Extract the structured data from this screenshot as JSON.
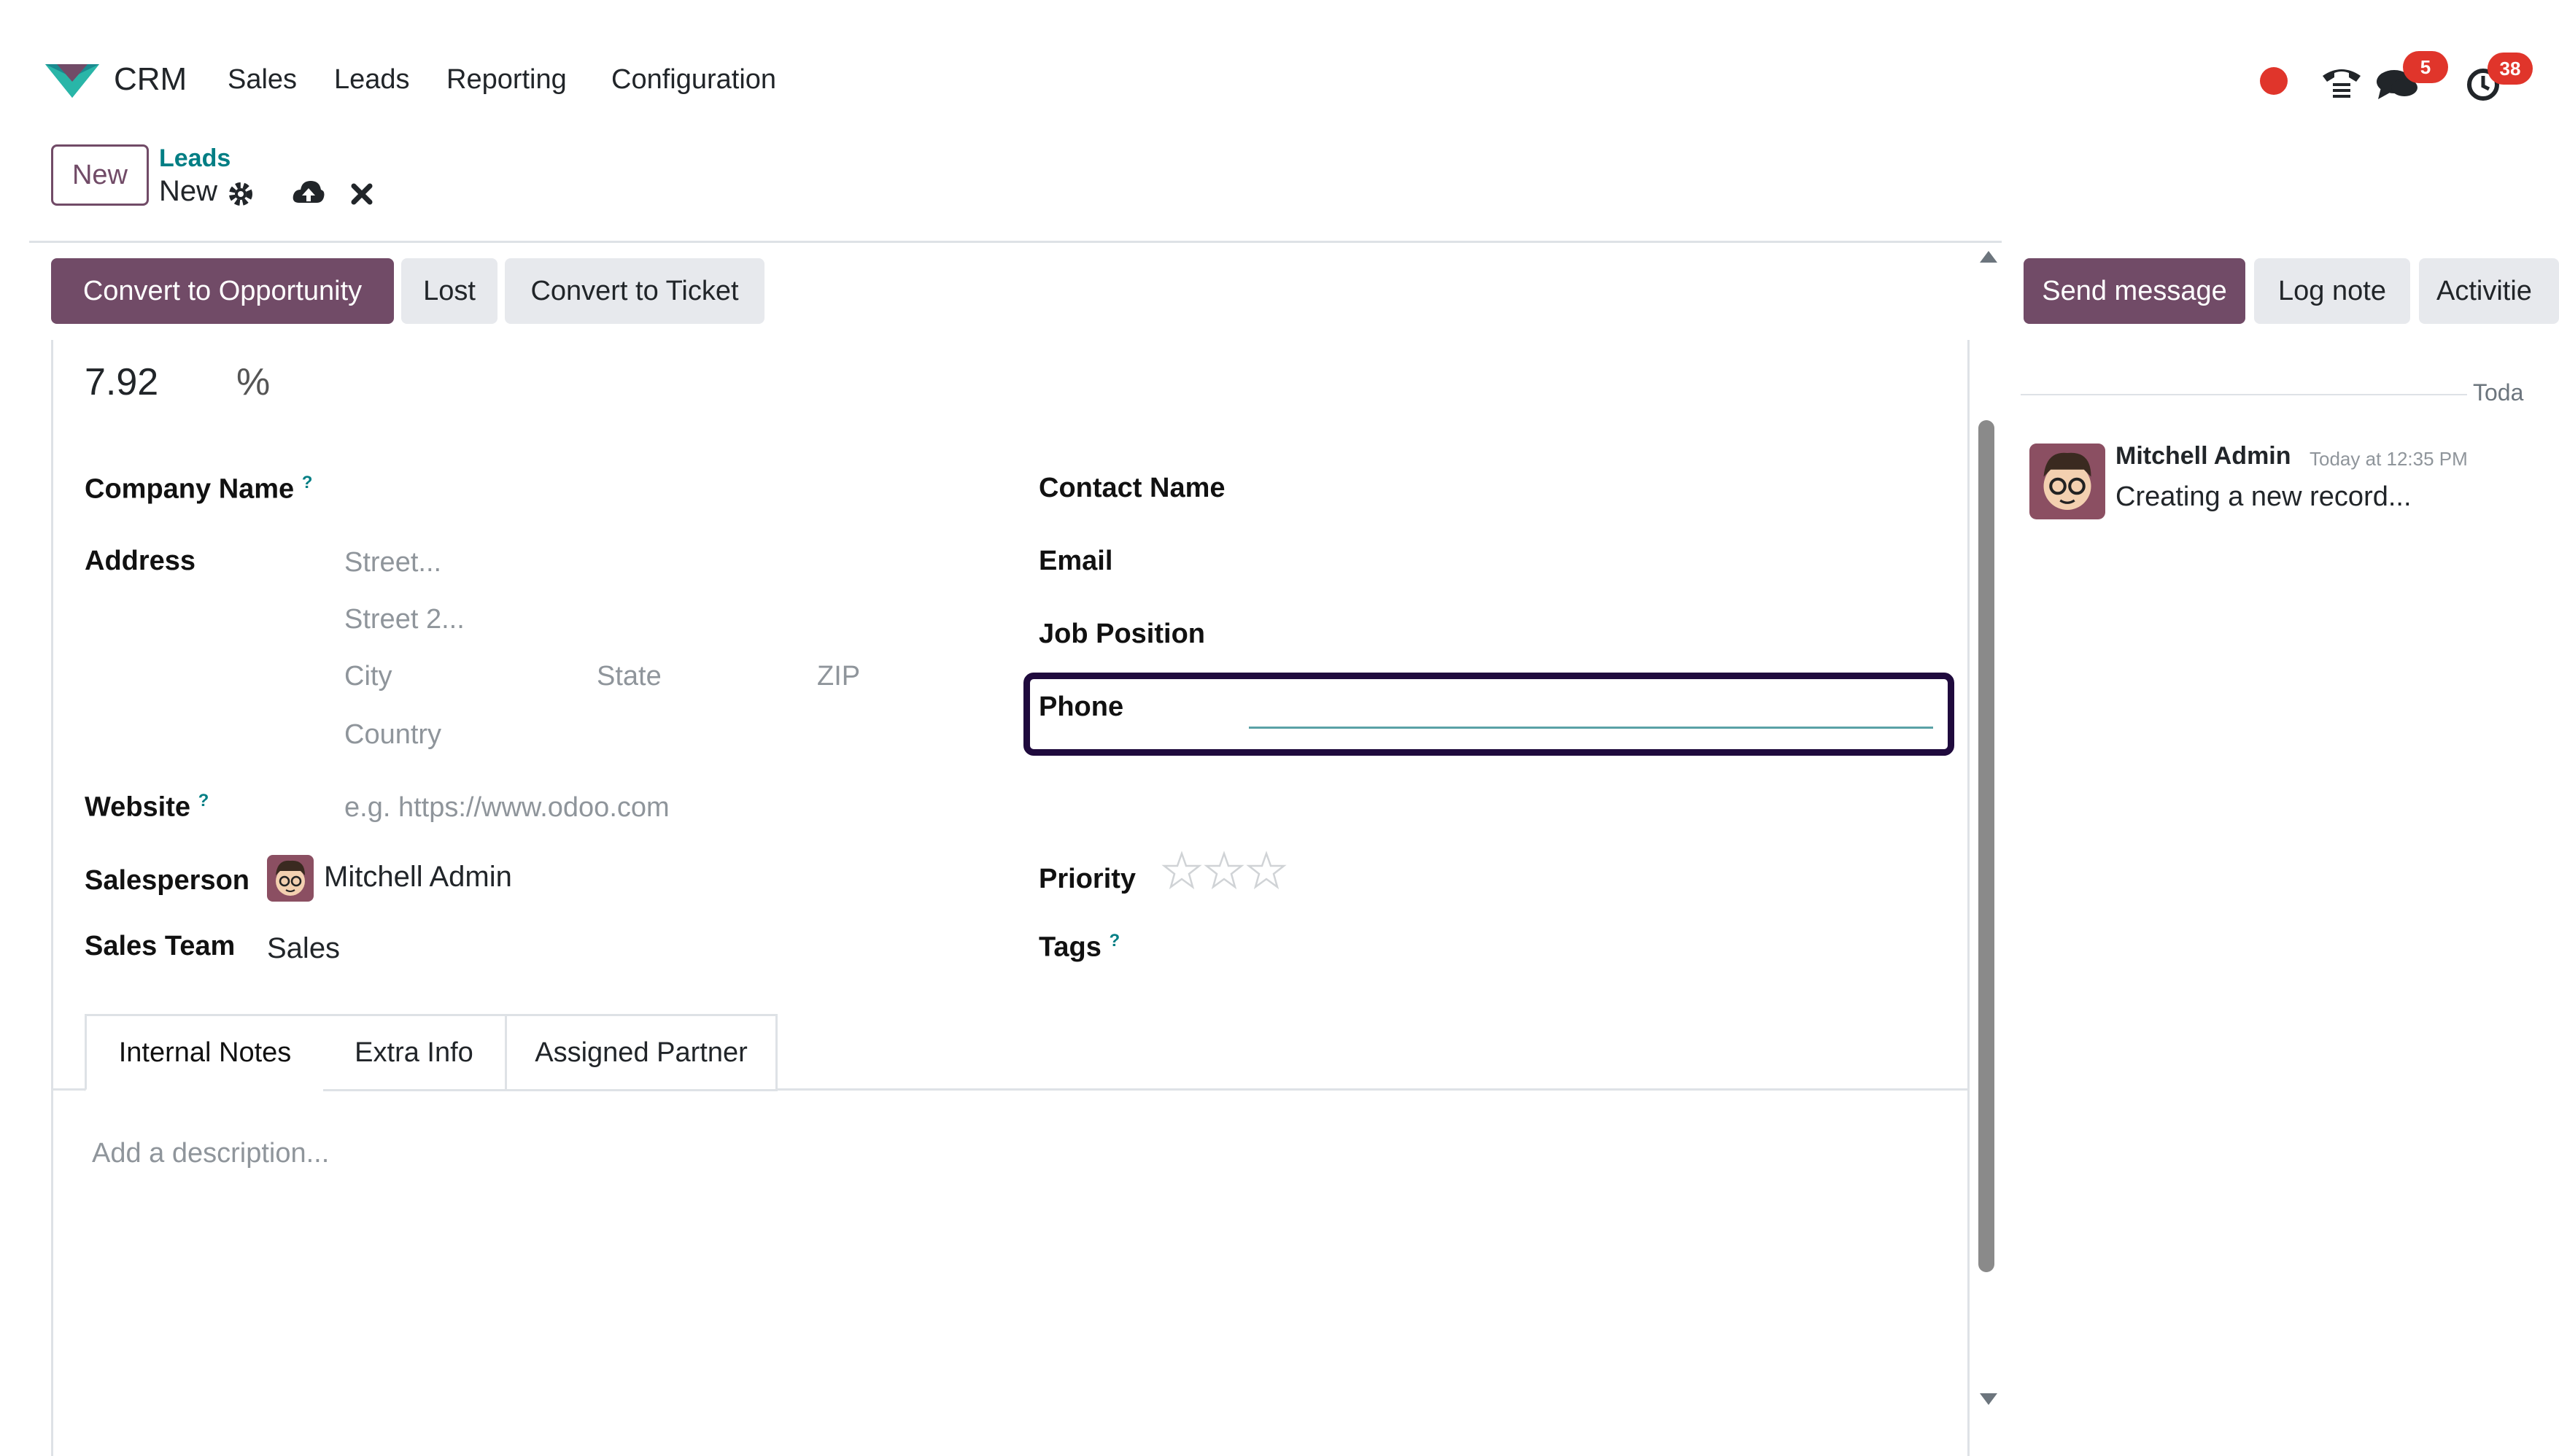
{
  "navbar": {
    "app_name": "CRM",
    "menu": [
      "Sales",
      "Leads",
      "Reporting",
      "Configuration"
    ],
    "icons": [
      "status-dot-icon",
      "phone-icon",
      "chat-icon",
      "clock-icon"
    ],
    "chat_badge": "5",
    "activity_badge": "38"
  },
  "breadcrumb": {
    "new_button": "New",
    "parent": "Leads",
    "current": "New"
  },
  "statusbar": {
    "convert_opportunity": "Convert to Opportunity",
    "lost": "Lost",
    "convert_ticket": "Convert to Ticket"
  },
  "form": {
    "probability": "7.92",
    "probability_unit": "%",
    "company_name_label": "Company Name",
    "address_label": "Address",
    "street_placeholder": "Street...",
    "street2_placeholder": "Street 2...",
    "city_placeholder": "City",
    "state_placeholder": "State",
    "zip_placeholder": "ZIP",
    "country_placeholder": "Country",
    "website_label": "Website",
    "website_placeholder": "e.g. https://www.odoo.com",
    "salesperson_label": "Salesperson",
    "salesperson_value": "Mitchell Admin",
    "sales_team_label": "Sales Team",
    "sales_team_value": "Sales",
    "contact_name_label": "Contact Name",
    "email_label": "Email",
    "job_position_label": "Job Position",
    "phone_label": "Phone",
    "priority_label": "Priority",
    "priority_stars": 0,
    "tags_label": "Tags",
    "help_mark": "?"
  },
  "tabs": {
    "internal_notes": "Internal Notes",
    "extra_info": "Extra Info",
    "assigned_partner": "Assigned Partner",
    "description_placeholder": "Add a description..."
  },
  "chatter": {
    "send_message": "Send message",
    "log_note": "Log note",
    "activities": "Activitie",
    "date_separator": "Toda",
    "message": {
      "author": "Mitchell Admin",
      "time": "Today at 12:35 PM",
      "body": "Creating a new record..."
    }
  },
  "colors": {
    "brand": "#714b67",
    "link": "#017e84",
    "badge": "#e0352b",
    "highlight_border": "#1f0a3d"
  }
}
